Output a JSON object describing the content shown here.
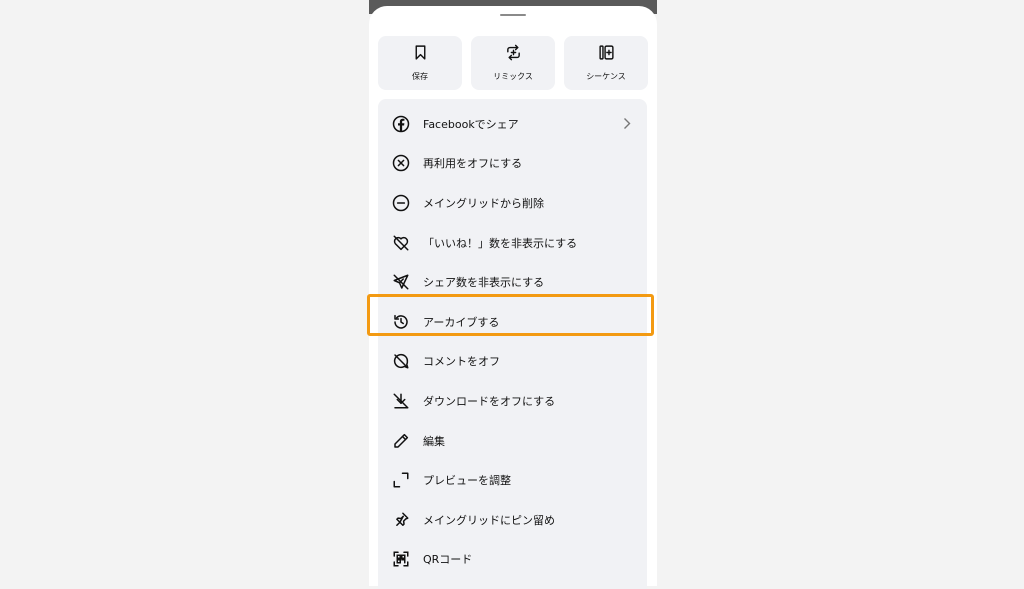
{
  "quick_actions": [
    {
      "label": "保存",
      "icon": "bookmark-icon"
    },
    {
      "label": "リミックス",
      "icon": "remix-icon"
    },
    {
      "label": "シーケンス",
      "icon": "sequence-icon"
    }
  ],
  "menu": {
    "items": [
      {
        "label": "Facebookでシェア",
        "icon": "facebook-icon"
      },
      {
        "label": "再利用をオフにする",
        "icon": "x-circle-icon"
      },
      {
        "label": "メイングリッドから削除",
        "icon": "minus-circle-icon"
      },
      {
        "label": "「いいね！」数を非表示にする",
        "icon": "heart-off-icon"
      },
      {
        "label": "シェア数を非表示にする",
        "icon": "send-off-icon"
      },
      {
        "label": "アーカイブする",
        "icon": "archive-history-icon"
      },
      {
        "label": "コメントをオフ",
        "icon": "comment-off-icon"
      },
      {
        "label": "ダウンロードをオフにする",
        "icon": "download-off-icon"
      },
      {
        "label": "編集",
        "icon": "pencil-icon"
      },
      {
        "label": "プレビューを調整",
        "icon": "crop-icon"
      },
      {
        "label": "メイングリッドにピン留め",
        "icon": "pin-icon"
      },
      {
        "label": "QRコード",
        "icon": "qr-code-icon"
      }
    ]
  },
  "colors": {
    "highlight": "#f39a12",
    "background": "#f3f3f3",
    "panel": "#f1f2f5"
  }
}
